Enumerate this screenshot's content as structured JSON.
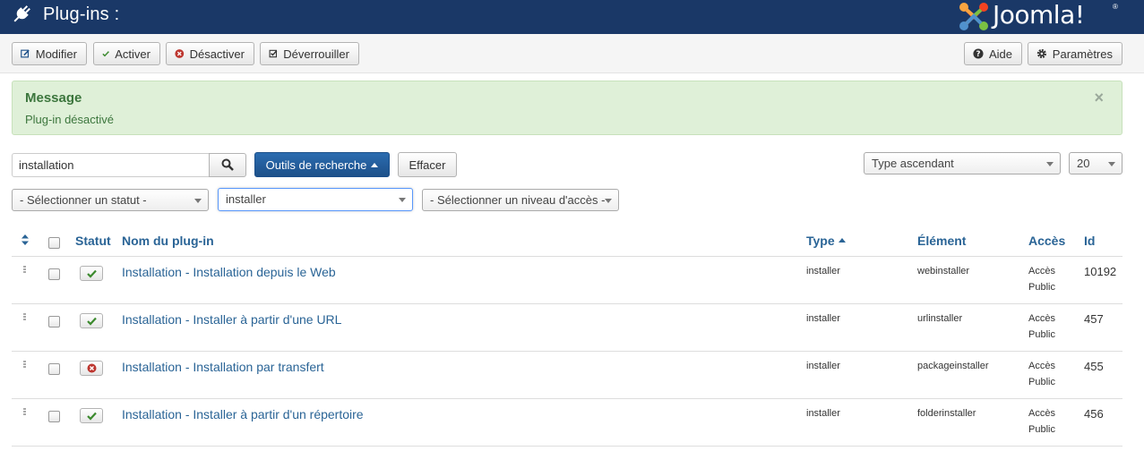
{
  "header": {
    "title": "Plug-ins :",
    "logo_text": "Joomla!",
    "logo_reg": "®",
    "bg_color": "#1a3867"
  },
  "toolbar": {
    "edit_label": "Modifier",
    "enable_label": "Activer",
    "disable_label": "Désactiver",
    "unlock_label": "Déverrouiller",
    "help_label": "Aide",
    "options_label": "Paramètres"
  },
  "message": {
    "heading": "Message",
    "text": "Plug-in désactivé",
    "close": "×"
  },
  "search": {
    "value": "installation",
    "tools_label": "Outils de recherche",
    "clear_label": "Effacer",
    "sort_value": "Type ascendant",
    "limit_value": "20"
  },
  "filters": {
    "status": "- Sélectionner un statut -",
    "folder": "installer",
    "access": "- Sélectionner un niveau d'accès -"
  },
  "table": {
    "columns": {
      "status": "Statut",
      "name": "Nom du plug-in",
      "type": "Type",
      "element": "Élément",
      "access": "Accès",
      "id": "Id"
    },
    "rows": [
      {
        "enabled": true,
        "name": "Installation - Installation depuis le Web",
        "type": "installer",
        "element": "webinstaller",
        "access1": "Accès",
        "access2": "Public",
        "id": "10192"
      },
      {
        "enabled": true,
        "name": "Installation - Installer à partir d'une URL",
        "type": "installer",
        "element": "urlinstaller",
        "access1": "Accès",
        "access2": "Public",
        "id": "457"
      },
      {
        "enabled": false,
        "name": "Installation - Installation par transfert",
        "type": "installer",
        "element": "packageinstaller",
        "access1": "Accès",
        "access2": "Public",
        "id": "455"
      },
      {
        "enabled": true,
        "name": "Installation - Installer à partir d'un répertoire",
        "type": "installer",
        "element": "folderinstaller",
        "access1": "Accès",
        "access2": "Public",
        "id": "456"
      }
    ]
  },
  "colors": {
    "link": "#2a6496",
    "success": "#3c763d",
    "success_bg": "#dff0d8",
    "primary_button": "#2b6cb0",
    "enabled_check": "#3c8a2e",
    "disabled_x": "#bd362f"
  }
}
